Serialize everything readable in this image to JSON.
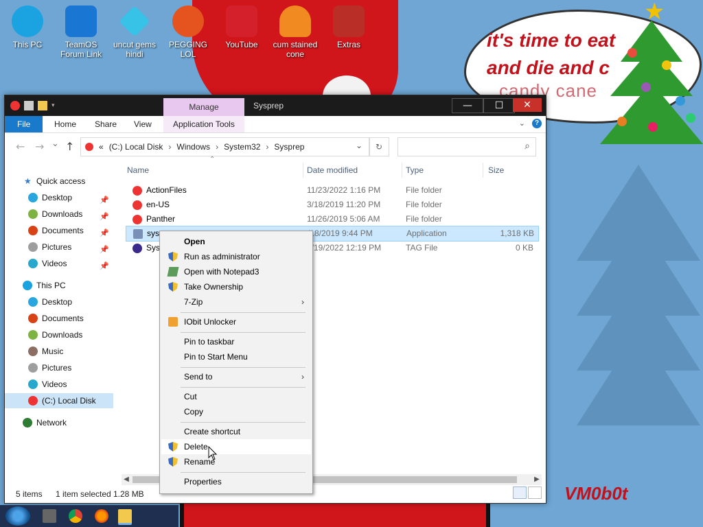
{
  "desktop": {
    "icons": [
      {
        "label": "This PC",
        "color": "#1aa3e0"
      },
      {
        "label": "TeamOS Forum Link",
        "color": "#1976d2"
      },
      {
        "label": "uncut gems hindi",
        "color": "#37c3e8"
      },
      {
        "label": "PEGGING LOL",
        "color": "#e5541f"
      },
      {
        "label": "YouTube",
        "color": "#d4202a"
      },
      {
        "label": "cum stained cone",
        "color": "#f08a21"
      },
      {
        "label": "Extras",
        "color": "#b92e26"
      }
    ],
    "speech_bubble_line1": "it's time to eat",
    "speech_bubble_line2": "and die and c",
    "speech_bubble_line3": "candy cane",
    "watermark": "VM0b0t"
  },
  "window": {
    "manage_tab": "Manage",
    "title": "Sysprep",
    "min_symbol": "—",
    "max_symbol": "☐",
    "close_symbol": "✕"
  },
  "ribbon": {
    "tabs": [
      "File",
      "Home",
      "Share",
      "View",
      "Application Tools"
    ],
    "help_symbol": "?"
  },
  "address": {
    "prefix": "«",
    "segments": [
      "(C:) Local Disk",
      "Windows",
      "System32",
      "Sysprep"
    ],
    "separator": "›",
    "search_placeholder": ""
  },
  "nav": {
    "quick_access": "Quick access",
    "quick_items": [
      "Desktop",
      "Downloads",
      "Documents",
      "Pictures",
      "Videos"
    ],
    "this_pc": "This PC",
    "pc_items": [
      "Desktop",
      "Documents",
      "Downloads",
      "Music",
      "Pictures",
      "Videos",
      "(C:) Local Disk"
    ],
    "network": "Network"
  },
  "columns": {
    "name": "Name",
    "date": "Date modified",
    "type": "Type",
    "size": "Size"
  },
  "files": [
    {
      "name": "ActionFiles",
      "date": "11/23/2022 1:16 PM",
      "type": "File folder",
      "size": ""
    },
    {
      "name": "en-US",
      "date": "3/18/2019 11:20 PM",
      "type": "File folder",
      "size": ""
    },
    {
      "name": "Panther",
      "date": "11/26/2019 5:06 AM",
      "type": "File folder",
      "size": ""
    },
    {
      "name": "syspr",
      "date": "/18/2019 9:44 PM",
      "type": "Application",
      "size": "1,318 KB"
    },
    {
      "name": "Sysp",
      "date": "2/19/2022 12:19 PM",
      "type": "TAG File",
      "size": "0 KB"
    }
  ],
  "status": {
    "items": "5 items",
    "selected": "1 item selected",
    "size": "1.28 MB"
  },
  "context_menu": {
    "items": [
      {
        "label": "Open",
        "bold": true
      },
      {
        "label": "Run as administrator"
      },
      {
        "label": "Open with Notepad3"
      },
      {
        "label": "Take Ownership"
      },
      {
        "label": "7-Zip"
      },
      {
        "label": "IObit Unlocker"
      },
      {
        "label": "Pin to taskbar"
      },
      {
        "label": "Pin to Start Menu"
      },
      {
        "label": "Send to"
      },
      {
        "label": "Cut"
      },
      {
        "label": "Copy"
      },
      {
        "label": "Create shortcut"
      },
      {
        "label": "Delete"
      },
      {
        "label": "Rename"
      },
      {
        "label": "Properties"
      }
    ],
    "submenu_arrow": "›"
  },
  "colors": {
    "accent": "#1979ca",
    "selection": "#cce8ff",
    "manage_tab": "#e9c8ef"
  }
}
